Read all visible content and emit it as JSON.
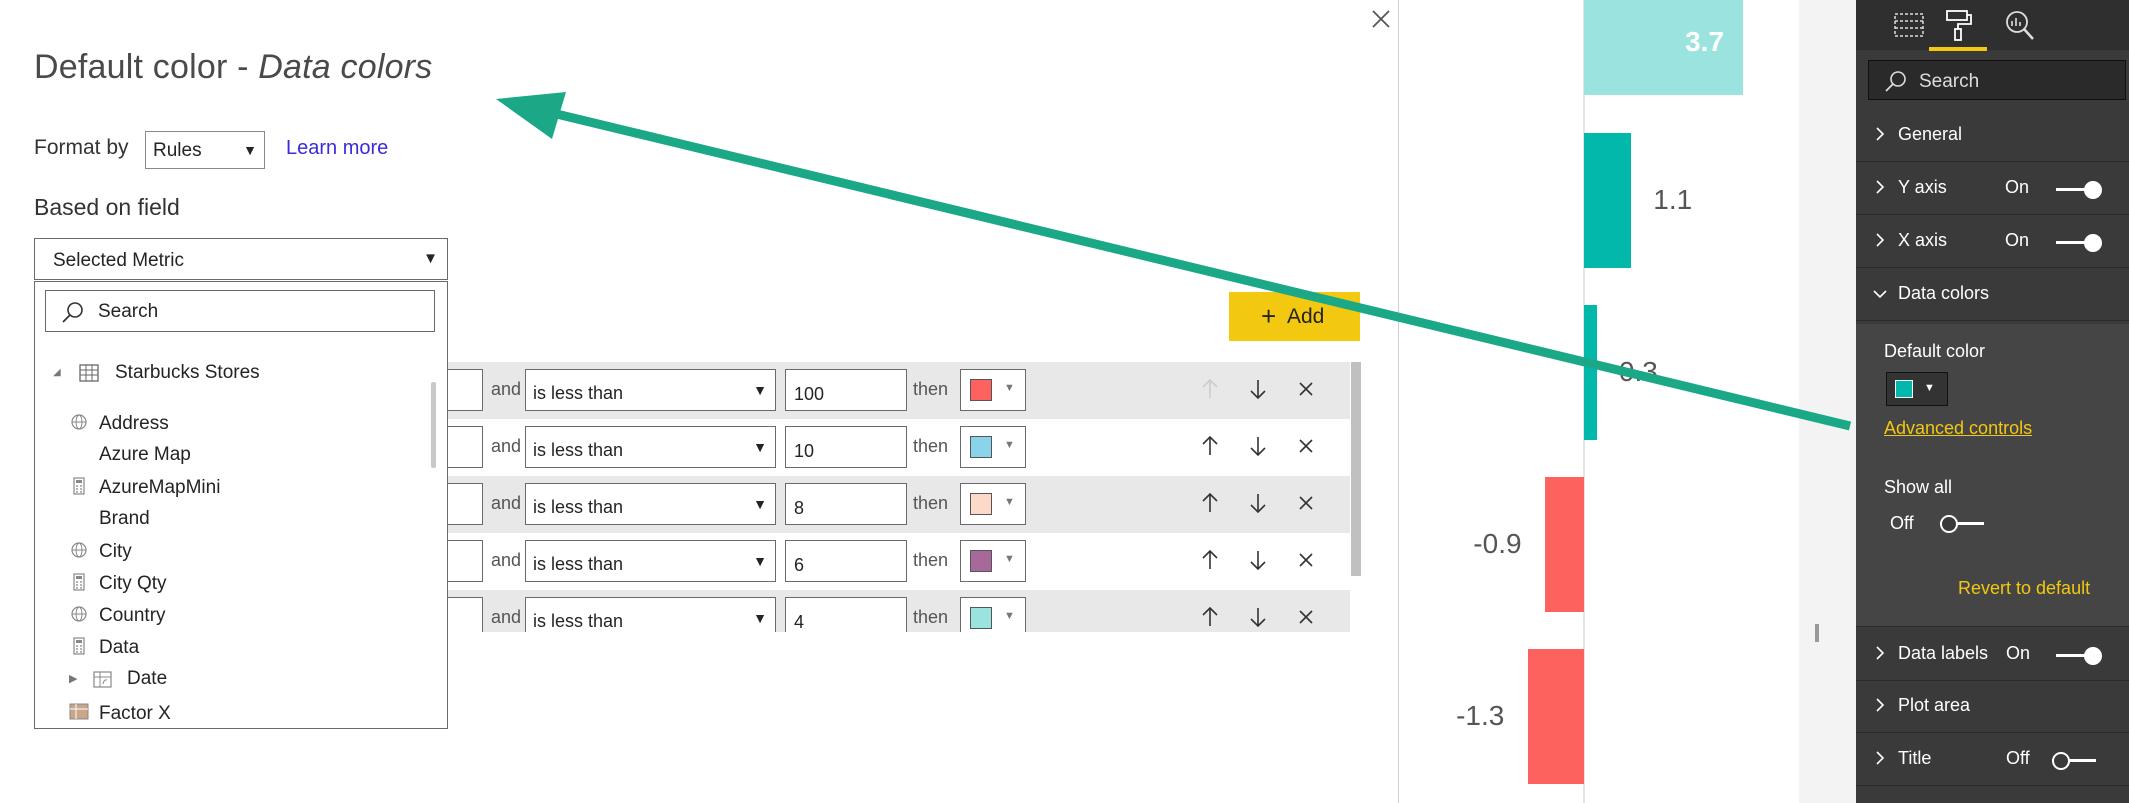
{
  "dialog": {
    "title_main": "Default color - ",
    "title_italic": "Data colors",
    "format_by_label": "Format by",
    "format_by_value": "Rules",
    "learn_more": "Learn more",
    "based_on_label": "Based on field",
    "field_value": "Selected Metric",
    "list_search_placeholder": "Search",
    "table_name": "Starbucks Stores",
    "fields": [
      {
        "label": "Address",
        "icon": "globe-icon"
      },
      {
        "label": "Azure Map",
        "icon": ""
      },
      {
        "label": "AzureMapMini",
        "icon": "calculator-icon"
      },
      {
        "label": "Brand",
        "icon": ""
      },
      {
        "label": "City",
        "icon": "globe-icon"
      },
      {
        "label": "City Qty",
        "icon": "calculator-icon"
      },
      {
        "label": "Country",
        "icon": "globe-icon"
      },
      {
        "label": "Data",
        "icon": "calculator-icon"
      },
      {
        "label": "Date",
        "icon": "calendar-table-icon"
      },
      {
        "label": "Factor X",
        "icon": "table-icon"
      }
    ],
    "add_label": "Add",
    "and_label": "and",
    "then_label": "then",
    "rules": [
      {
        "condition": "is less than",
        "value": "100",
        "color": "#fd625e"
      },
      {
        "condition": "is less than",
        "value": "10",
        "color": "#8ad4eb"
      },
      {
        "condition": "is less than",
        "value": "8",
        "color": "#fcd9c8"
      },
      {
        "condition": "is less than",
        "value": "6",
        "color": "#a66999"
      },
      {
        "condition": "is less than",
        "value": "4",
        "color": "#9be3de"
      }
    ]
  },
  "chart": {
    "colors": {
      "teal": "#01b8aa",
      "light_teal": "#9be3de",
      "red": "#fd625e"
    },
    "bars": [
      {
        "label": "3.7",
        "value": 3.7,
        "color": "#9be3de"
      },
      {
        "label": "1.1",
        "value": 1.1,
        "color": "#01b8aa"
      },
      {
        "label": "0.3",
        "value": 0.3,
        "color": "#01b8aa"
      },
      {
        "label": "-0.9",
        "value": -0.9,
        "color": "#fd625e"
      },
      {
        "label": "-1.3",
        "value": -1.3,
        "color": "#fd625e"
      }
    ]
  },
  "pane": {
    "search_placeholder": "Search",
    "sections": {
      "general": "General",
      "y_axis": "Y axis",
      "x_axis": "X axis",
      "data_colors": "Data colors",
      "data_labels": "Data labels",
      "plot_area": "Plot area",
      "title": "Title"
    },
    "on": "On",
    "off": "Off",
    "default_color_label": "Default color",
    "default_color": "#01b8aa",
    "advanced_controls": "Advanced controls",
    "show_all_label": "Show all",
    "revert_label": "Revert to default",
    "accent": "#f2c811"
  }
}
